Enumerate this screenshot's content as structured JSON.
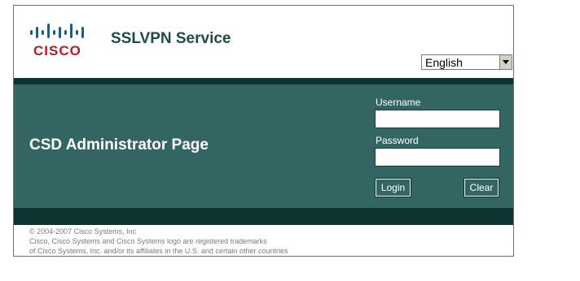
{
  "brand": {
    "logo_text": "CISCO",
    "service_title": "SSLVPN Service"
  },
  "language": {
    "selected": "English"
  },
  "login": {
    "page_title": "CSD Administrator Page",
    "username_label": "Username",
    "username_value": "",
    "password_label": "Password",
    "password_value": "",
    "login_button": "Login",
    "clear_button": "Clear"
  },
  "colors": {
    "dark_band": "#0e3432",
    "panel": "#336663",
    "title_text": "#1e4a48",
    "logo_red": "#b01e23"
  },
  "footer": {
    "lines": [
      "© 2004-2007 Cisco Systems, Inc",
      "Cisco, Cisco Systems and Cisco Systems logo are registered trademarks",
      "of Cisco Systems, Inc. and/or its affiliates in the U.S. and certain other countries"
    ]
  }
}
